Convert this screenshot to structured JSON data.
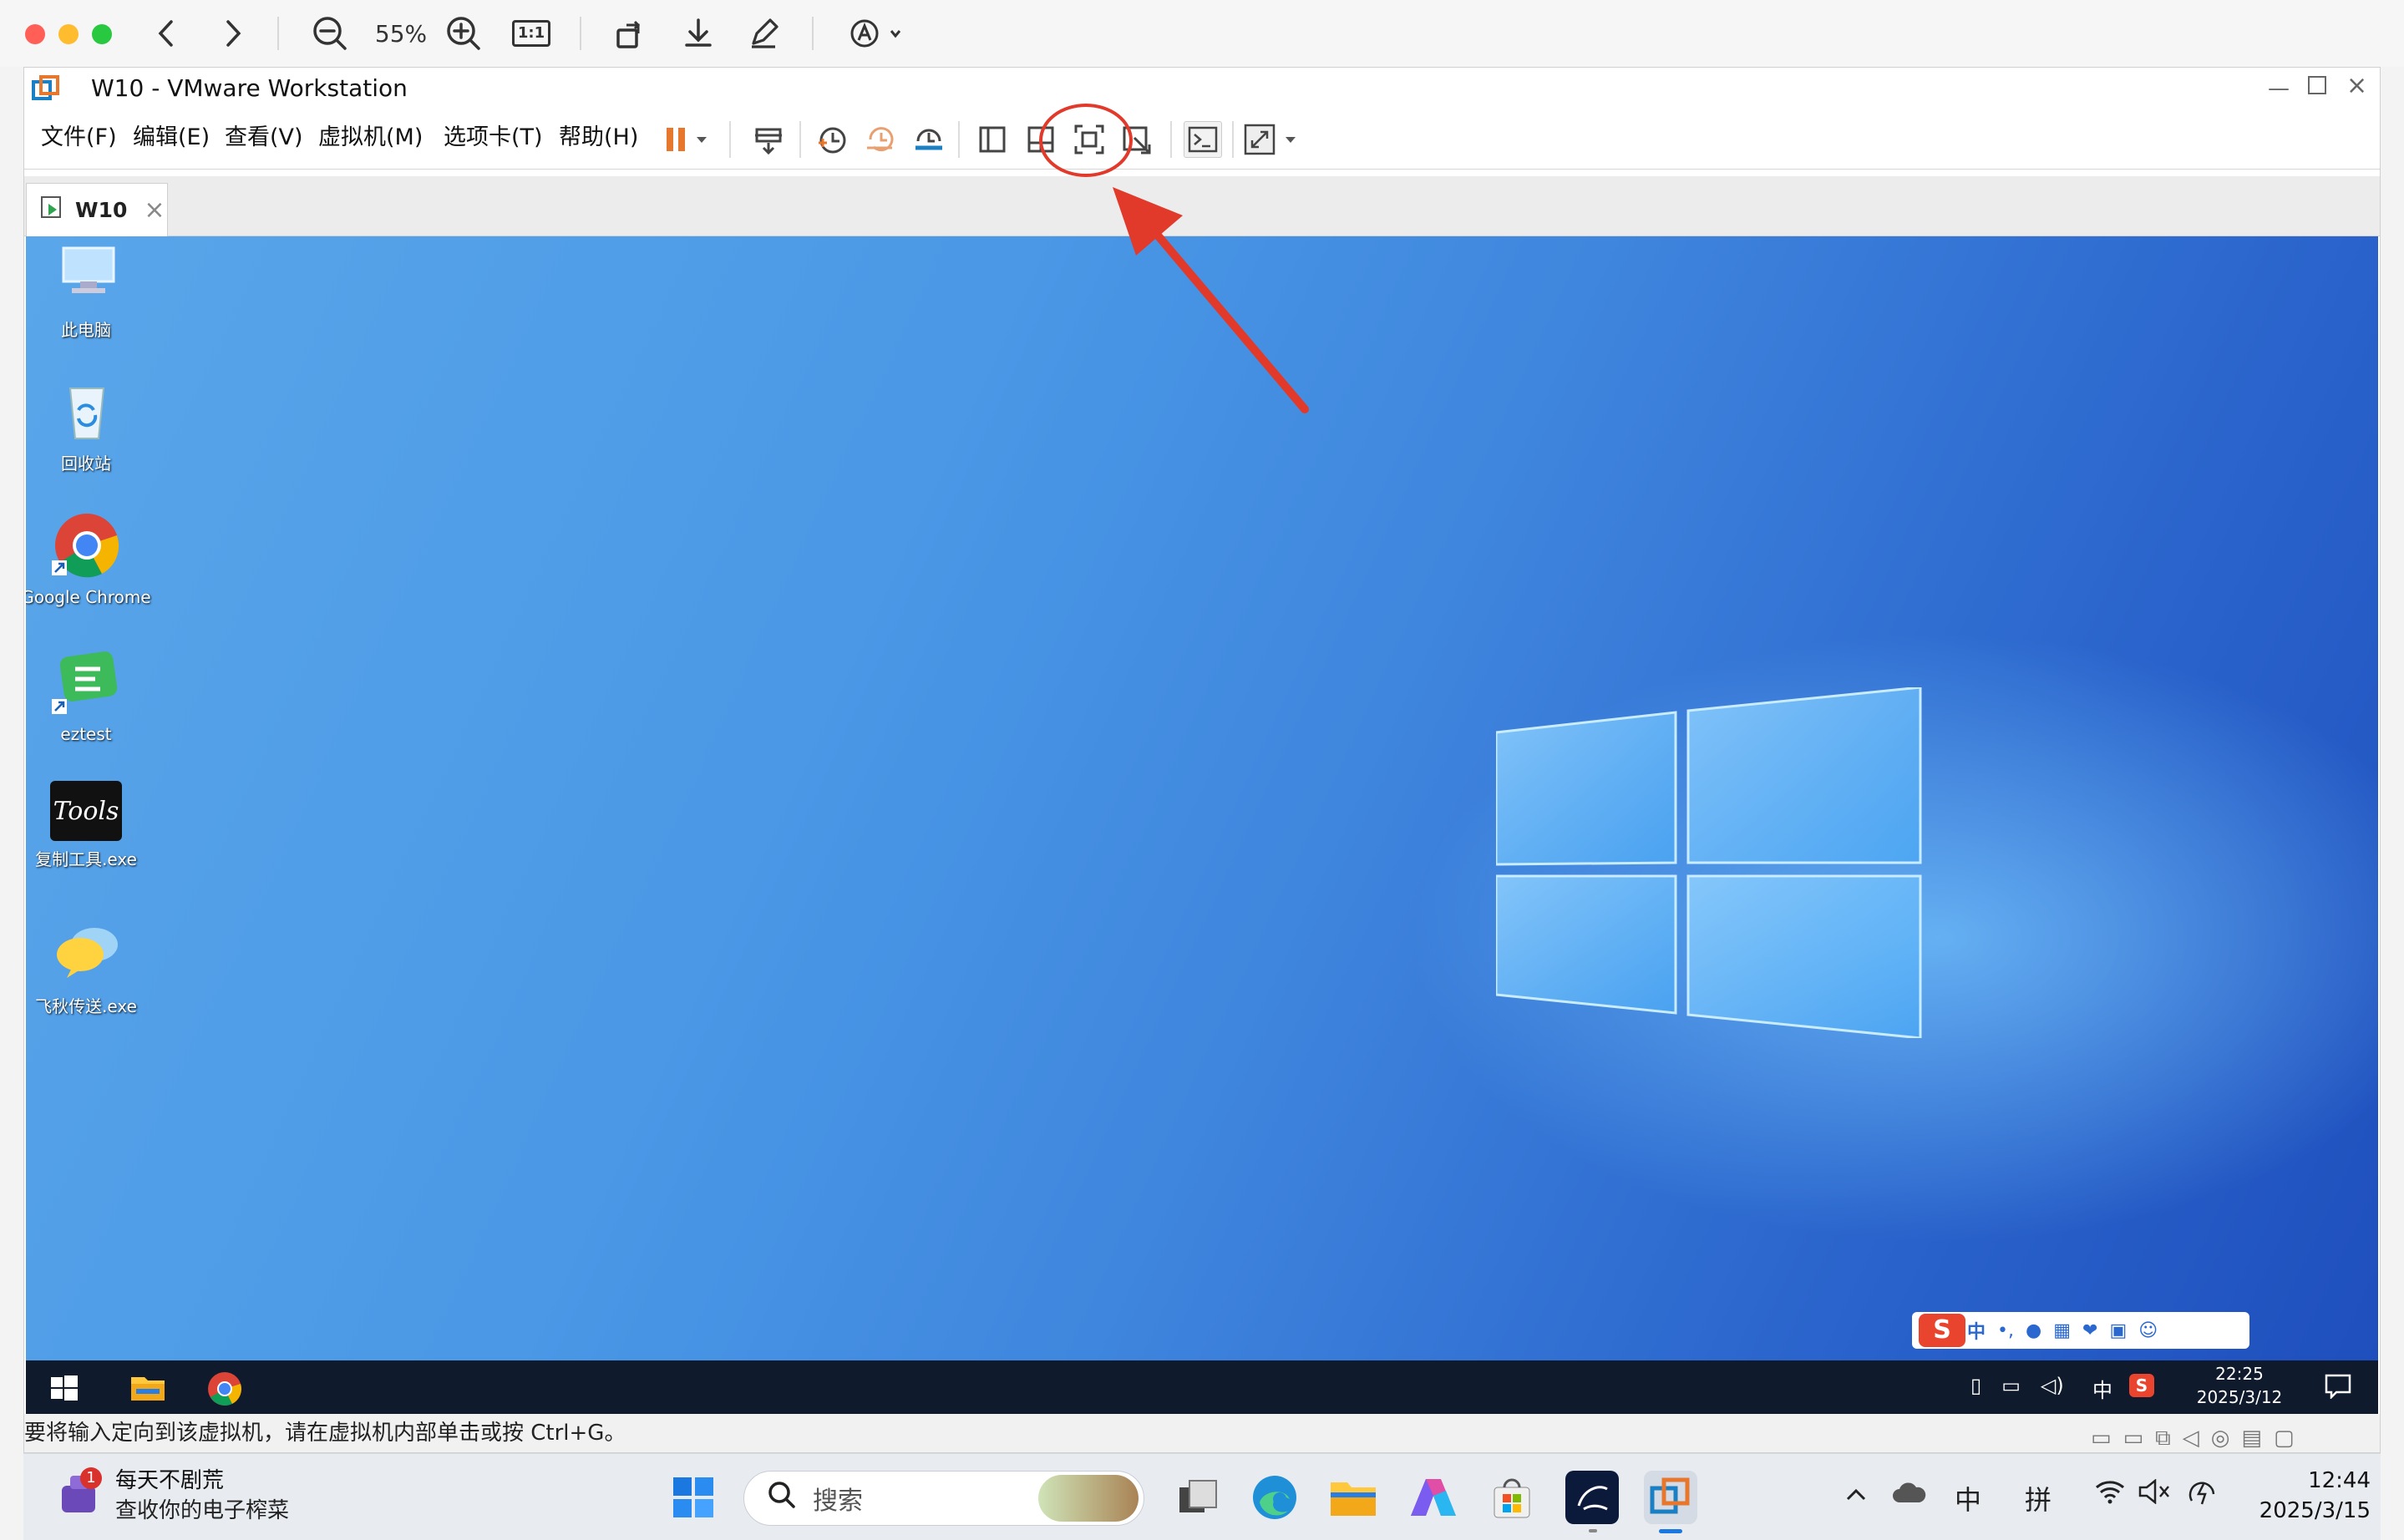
{
  "preview": {
    "zoom": "55%",
    "actual_size_label": "1:1"
  },
  "vm": {
    "title": "W10 - VMware Workstation",
    "menu": [
      "文件(F)",
      "编辑(E)",
      "查看(V)",
      "虚拟机(M)",
      "选项卡(T)",
      "帮助(H)"
    ],
    "tab_label": "W10",
    "status_message": "要将输入定向到该虚拟机，请在虚拟机内部单击或按 Ctrl+G。"
  },
  "guest": {
    "desktop_icons": [
      {
        "label": "此电脑",
        "icon": "computer-icon"
      },
      {
        "label": "回收站",
        "icon": "recycle-bin-icon"
      },
      {
        "label": "Google Chrome",
        "icon": "chrome-icon"
      },
      {
        "label": "eztest",
        "icon": "eztest-icon"
      },
      {
        "label": "复制工具.exe",
        "icon": "tools-icon",
        "icon_text": "Tools"
      },
      {
        "label": "飞秋传送.exe",
        "icon": "feiqiu-icon"
      }
    ],
    "ime_lang": "中",
    "tray_lang": "中",
    "clock_time": "22:25",
    "clock_date": "2025/3/12"
  },
  "host": {
    "notification": {
      "badge": "1",
      "title": "每天不剧荒",
      "subtitle": "查收你的电子榨菜"
    },
    "search_placeholder": "搜索",
    "tray_lang1": "中",
    "tray_lang2": "拼",
    "clock_time": "12:44",
    "clock_date": "2025/3/15"
  },
  "colors": {
    "accent_orange": "#e8772e",
    "annotation_red": "#e23a2a",
    "guest_taskbar": "#0f1a2c"
  }
}
